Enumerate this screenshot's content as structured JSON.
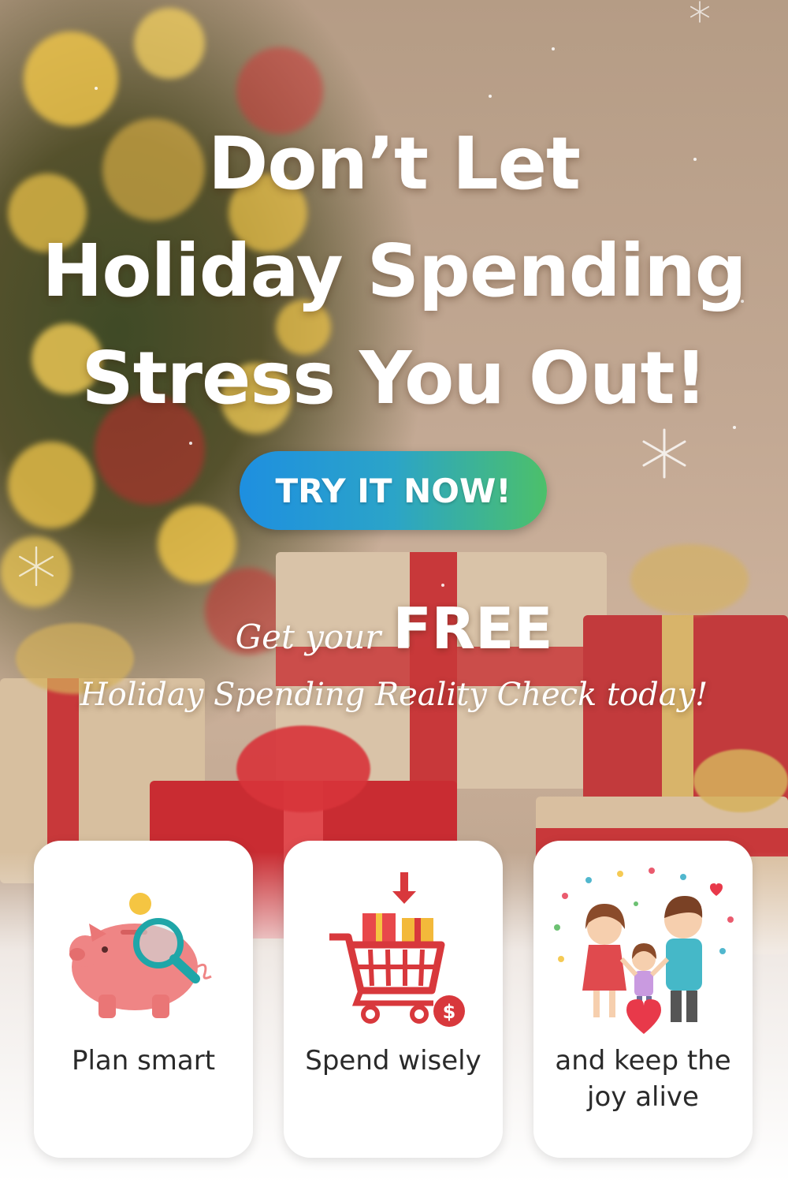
{
  "headline": {
    "line1": "Don’t Let",
    "line2": "Holiday Spending",
    "line3": "Stress You Out!"
  },
  "cta": {
    "label": "TRY IT NOW!"
  },
  "offer": {
    "prefix": "Get your",
    "highlight": "FREE",
    "line2": "Holiday Spending Reality Check today!"
  },
  "features": [
    {
      "label": "Plan smart",
      "icon": "piggy-bank-magnifier-icon"
    },
    {
      "label": "Spend wisely",
      "icon": "shopping-cart-gifts-icon"
    },
    {
      "label": "and keep the joy alive",
      "icon": "happy-family-icon"
    }
  ],
  "colors": {
    "cta_start": "#1e8fe0",
    "cta_end": "#4cc06a",
    "accent_red": "#d8383c",
    "piggy_pink": "#ef8585",
    "magnifier_teal": "#1fa6a8"
  }
}
